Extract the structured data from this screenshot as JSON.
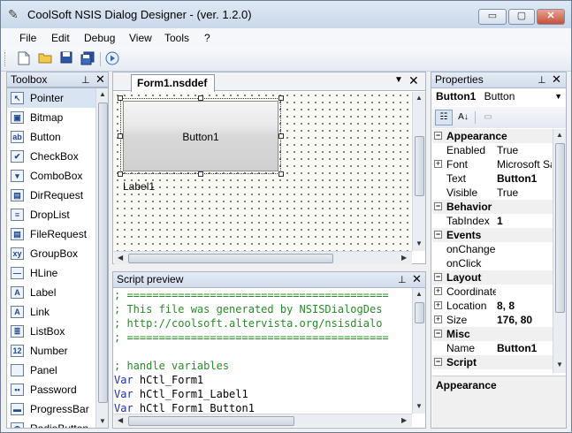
{
  "app": {
    "title": "CoolSoft NSIS Dialog Designer - (ver. 1.2.0)",
    "window_buttons": {
      "minimize": "▭",
      "maximize": "▢",
      "close": "✕"
    }
  },
  "menu": [
    "File",
    "Edit",
    "Debug",
    "View",
    "Tools",
    "?"
  ],
  "toolbar": {
    "icons": [
      "new-file-icon",
      "open-folder-icon",
      "save-icon",
      "save-all-icon",
      "run-icon"
    ]
  },
  "toolbox": {
    "title": "Toolbox",
    "items": [
      {
        "label": "Pointer",
        "icon": "pointer-icon",
        "glyph": "↖"
      },
      {
        "label": "Bitmap",
        "icon": "bitmap-icon",
        "glyph": "▣"
      },
      {
        "label": "Button",
        "icon": "button-icon",
        "glyph": "ab"
      },
      {
        "label": "CheckBox",
        "icon": "checkbox-icon",
        "glyph": "✔"
      },
      {
        "label": "ComboBox",
        "icon": "combobox-icon",
        "glyph": "▾"
      },
      {
        "label": "DirRequest",
        "icon": "dirrequest-icon",
        "glyph": "▤"
      },
      {
        "label": "DropList",
        "icon": "droplist-icon",
        "glyph": "≡"
      },
      {
        "label": "FileRequest",
        "icon": "filerequest-icon",
        "glyph": "▤"
      },
      {
        "label": "GroupBox",
        "icon": "groupbox-icon",
        "glyph": "xy"
      },
      {
        "label": "HLine",
        "icon": "hline-icon",
        "glyph": "—"
      },
      {
        "label": "Label",
        "icon": "label-icon",
        "glyph": "A"
      },
      {
        "label": "Link",
        "icon": "link-icon",
        "glyph": "A"
      },
      {
        "label": "ListBox",
        "icon": "listbox-icon",
        "glyph": "≣"
      },
      {
        "label": "Number",
        "icon": "number-icon",
        "glyph": "12"
      },
      {
        "label": "Panel",
        "icon": "panel-icon",
        "glyph": ""
      },
      {
        "label": "Password",
        "icon": "password-icon",
        "glyph": "••"
      },
      {
        "label": "ProgressBar",
        "icon": "progressbar-icon",
        "glyph": "▬"
      },
      {
        "label": "RadioButton",
        "icon": "radiobutton-icon",
        "glyph": "◉"
      }
    ],
    "selected_index": 0
  },
  "designer": {
    "tab_label": "Form1.nsddef",
    "button_text": "Button1",
    "label_text": "Label1"
  },
  "script_preview": {
    "title": "Script preview",
    "lines": [
      {
        "type": "com",
        "text": "; ========================================="
      },
      {
        "type": "com",
        "text": "; This file was generated by NSISDialogDes"
      },
      {
        "type": "com",
        "text": "; http://coolsoft.altervista.org/nsisdialo"
      },
      {
        "type": "com",
        "text": "; ========================================="
      },
      {
        "type": "blank",
        "text": ""
      },
      {
        "type": "com",
        "text": "; handle variables"
      },
      {
        "type": "var",
        "kw": "Var",
        "text": " hCtl_Form1"
      },
      {
        "type": "var",
        "kw": "Var",
        "text": " hCtl_Form1_Label1"
      },
      {
        "type": "var",
        "kw": "Var",
        "text": " hCtl_Form1_Button1"
      }
    ]
  },
  "properties": {
    "title": "Properties",
    "object_name": "Button1",
    "object_type": "Button",
    "rows": [
      {
        "cat": true,
        "key": "Appearance",
        "expander": "−"
      },
      {
        "key": "Enabled",
        "value": "True"
      },
      {
        "key": "Font",
        "value": "Microsoft Sans",
        "expander": "+"
      },
      {
        "key": "Text",
        "value": "Button1",
        "bold": true
      },
      {
        "key": "Visible",
        "value": "True"
      },
      {
        "cat": true,
        "key": "Behavior",
        "expander": "−"
      },
      {
        "key": "TabIndex",
        "value": "1",
        "bold": true
      },
      {
        "cat": true,
        "key": "Events",
        "expander": "−"
      },
      {
        "key": "onChange",
        "value": ""
      },
      {
        "key": "onClick",
        "value": ""
      },
      {
        "cat": true,
        "key": "Layout",
        "expander": "−"
      },
      {
        "key": "Coordinates",
        "value": "",
        "expander": "+"
      },
      {
        "key": "Location",
        "value": "8, 8",
        "bold": true,
        "expander": "+"
      },
      {
        "key": "Size",
        "value": "176, 80",
        "bold": true,
        "expander": "+"
      },
      {
        "cat": true,
        "key": "Misc",
        "expander": "−"
      },
      {
        "key": "Name",
        "value": "Button1",
        "bold": true
      },
      {
        "cat": true,
        "key": "Script",
        "expander": "−"
      }
    ],
    "description": "Appearance"
  }
}
